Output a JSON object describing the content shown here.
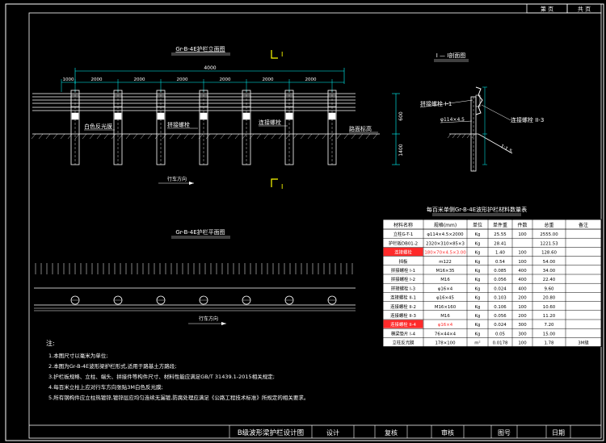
{
  "colors": {
    "background": "#000000",
    "line": "#ffffff",
    "dim": "#00ffff",
    "section_mark": "#ffff00",
    "highlight": "#ff2a2a",
    "table_bg": "#ffffff",
    "table_text": "#000000"
  },
  "top_right": {
    "box1": "第 页",
    "box2": "共 页"
  },
  "elevation": {
    "title": "Gr-B-4E护栏立面图",
    "section_mark": "I",
    "dims_top": [
      "4000"
    ],
    "dims_mid": [
      "1000",
      "2000",
      "2000",
      "2000",
      "2000",
      "2000",
      "2000"
    ],
    "dim_height": "600",
    "dim_bottom": "1400",
    "labels": {
      "reflector": "白色反光膜",
      "connector": "拼接螺栓",
      "connect_bolt": "连接螺栓",
      "road_surface": "路面标高"
    },
    "direction": "行车方向"
  },
  "section": {
    "title": "I — I剖面图",
    "labels": {
      "bolt_top": "拼接螺栓 I-1",
      "bolt_side": "连接螺栓 II-3",
      "pipe": "φ114×4.5",
      "slope": "1:1.5"
    }
  },
  "plan": {
    "title": "Gr-B-4E护栏平面图",
    "direction": "行车方向"
  },
  "table": {
    "title": "每百米单侧Gr-B-4E波形护栏材料数量表",
    "headers": [
      "材料名称",
      "规格(mm)",
      "单位",
      "单件重",
      "件数",
      "总重",
      "备注"
    ],
    "rows": [
      [
        "立柱G-T-1",
        "φ114×4.5×2000",
        "Kg",
        "25.55",
        "100",
        "2555.00",
        ""
      ],
      [
        "护栏板DB01-2",
        "2320×310×85×3",
        "Kg",
        "28.41",
        "",
        "1221.53",
        ""
      ],
      [
        "连接螺栓",
        "180×70×4.5×3.00",
        "Kg",
        "1.40",
        "100",
        "128.60",
        ""
      ],
      [
        "挡板",
        "m122",
        "Kg",
        "0.54",
        "100",
        "54.00",
        ""
      ],
      [
        "拼接螺栓 I-1",
        "M16×35",
        "Kg",
        "0.085",
        "400",
        "34.00",
        ""
      ],
      [
        "拼接螺栓 I-2",
        "M16",
        "Kg",
        "0.056",
        "400",
        "22.40",
        ""
      ],
      [
        "拼接螺栓 I-3",
        "φ16×4",
        "Kg",
        "0.024",
        "400",
        "9.60",
        ""
      ],
      [
        "连接螺栓 II-1",
        "φ16×45",
        "Kg",
        "0.103",
        "200",
        "20.80",
        ""
      ],
      [
        "连接螺栓 II-2",
        "M16×160",
        "Kg",
        "0.106",
        "100",
        "10.60",
        ""
      ],
      [
        "连接螺栓 II-3",
        "M16",
        "Kg",
        "0.056",
        "200",
        "11.20",
        ""
      ],
      [
        "连接螺栓 II-4",
        "φ16×4",
        "Kg",
        "0.024",
        "300",
        "7.20",
        ""
      ],
      [
        "横梁垫片 I-4",
        "76×44×4",
        "Kg",
        "0.05",
        "300",
        "15.00",
        ""
      ],
      [
        "立柱反光膜",
        "178×100",
        "m²",
        "0.0178",
        "100",
        "1.78",
        "3M级"
      ]
    ],
    "highlight_rows": [
      2,
      10
    ]
  },
  "notes": {
    "heading": "注:",
    "items": [
      "1.本图尺寸以毫米为单位;",
      "2.本图为Gr-B-4E波形梁护栏形式,适用于路基土方路段;",
      "3.护栏板规格、立柱、端头、拼接件等构件尺寸、材料性能应满足GB/T 31439.1-2015相关规定;",
      "4.每百米立柱上应对行车方向张贴3M白色反光膜;",
      "5.所有钢构件应立柱热镀锌,镀锌层应均匀连续无漏镀,防腐处理应满足《公路工程技术标准》所规定的相关要求。"
    ]
  },
  "title_block": {
    "drawing_title": "B级波形梁护栏设计图",
    "cells": [
      "设计",
      "复核",
      "审核",
      "图号",
      "日期"
    ]
  }
}
